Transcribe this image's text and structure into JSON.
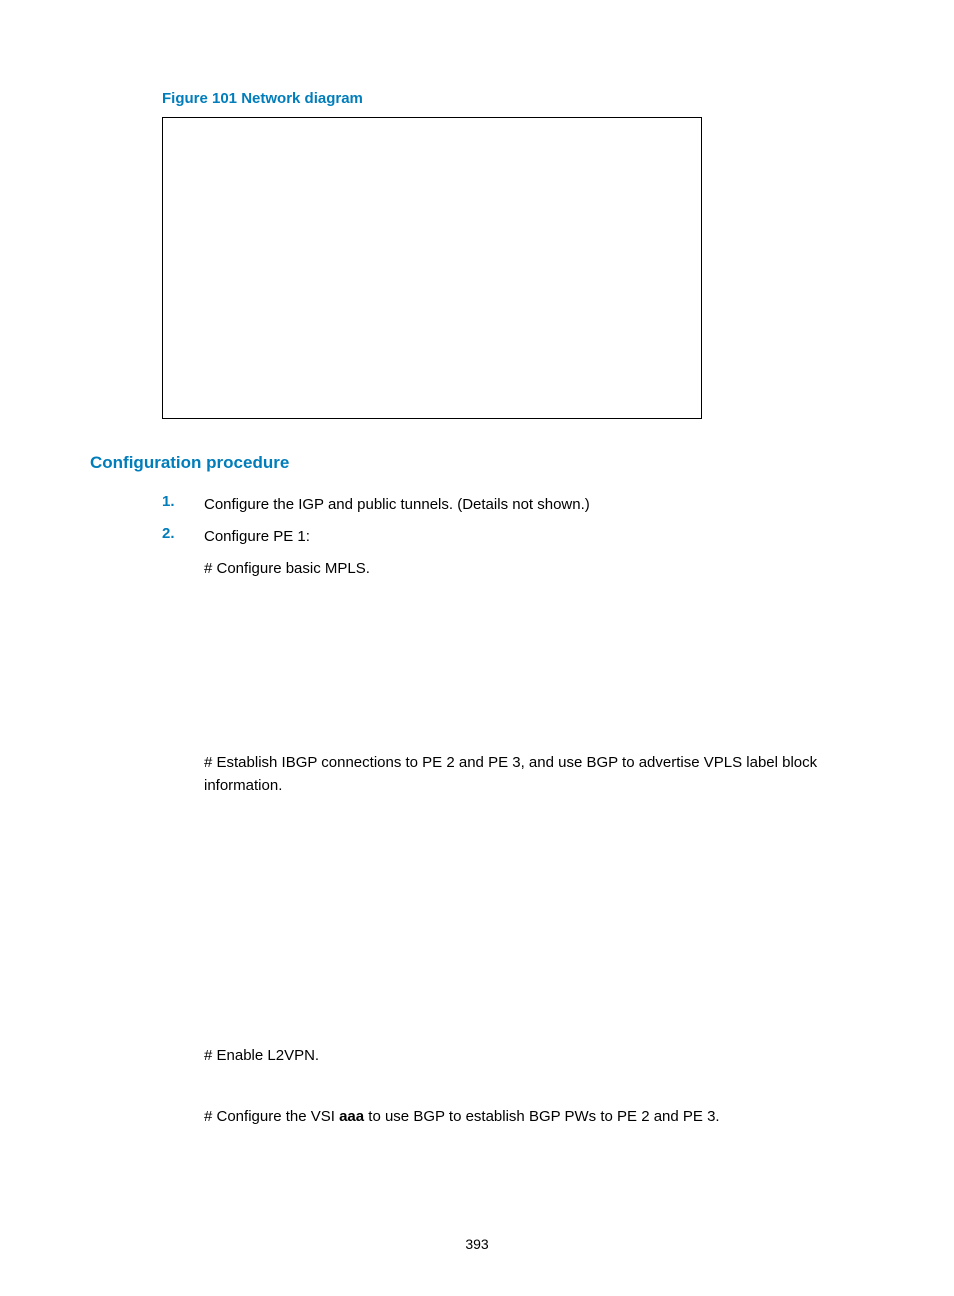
{
  "figure_caption": "Figure 101 Network diagram",
  "section_heading": "Configuration procedure",
  "list": {
    "item1_num": "1.",
    "item1_text": "Configure the IGP and public tunnels. (Details not shown.)",
    "item2_num": "2.",
    "item2_text": "Configure PE 1:"
  },
  "sublines": {
    "basic_mpls": "# Configure basic MPLS.",
    "ibgp_para": "# Establish IBGP connections to PE 2 and PE 3, and use BGP to advertise VPLS label block information.",
    "enable_l2vpn": "# Enable L2VPN.",
    "vsi_prefix": "# Configure the VSI ",
    "vsi_bold": "aaa",
    "vsi_suffix": " to use BGP to establish BGP PWs to PE 2 and PE 3."
  },
  "page_number": "393"
}
